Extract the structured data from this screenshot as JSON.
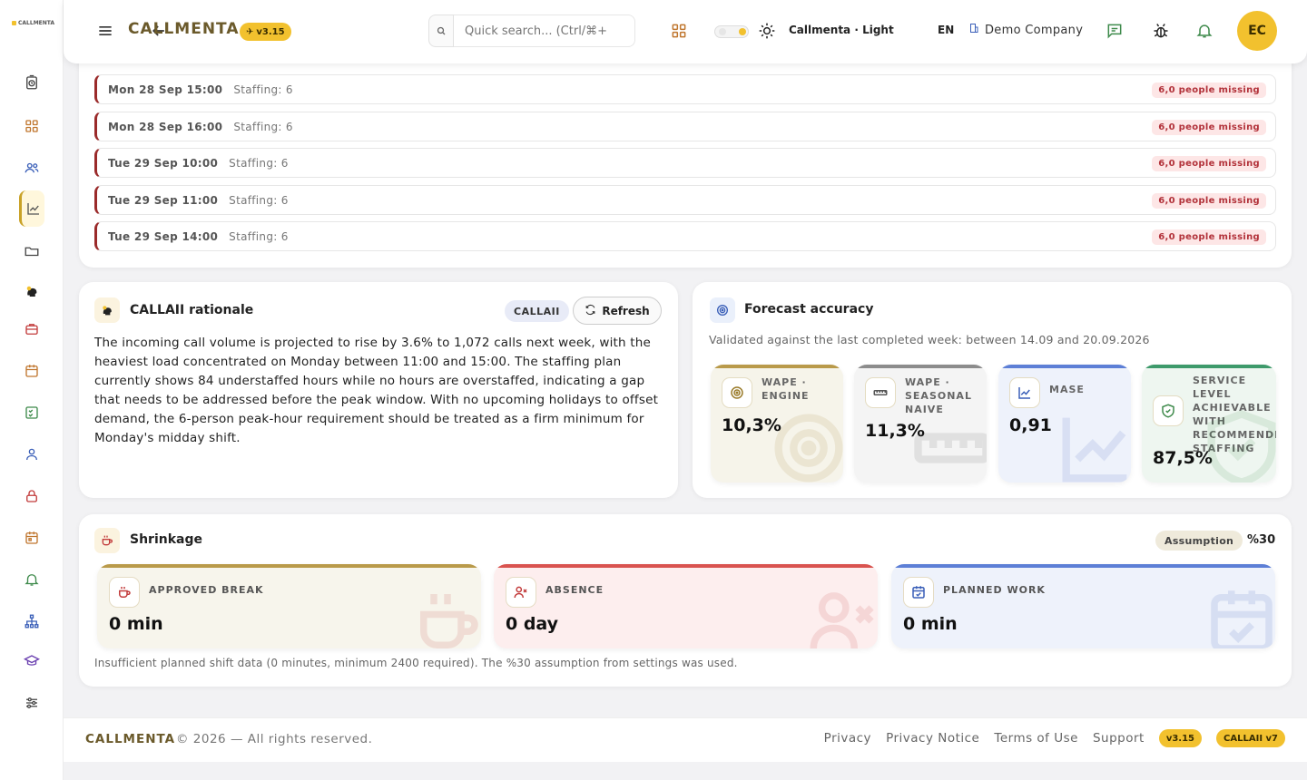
{
  "app": {
    "brand_mini": "CALLMENTA",
    "name": "CALLMENTA",
    "version": "v3.15"
  },
  "header": {
    "search_placeholder": "Quick search... (Ctrl/⌘+",
    "theme_label": "Callmenta · Light",
    "language": "EN",
    "company": "Demo Company",
    "avatar_initials": "EC"
  },
  "alerts": [
    {
      "time": "Mon 28 Sep 15:00",
      "staffing": "Staffing: 6",
      "badge": "6,0 people missing"
    },
    {
      "time": "Mon 28 Sep 16:00",
      "staffing": "Staffing: 6",
      "badge": "6,0 people missing"
    },
    {
      "time": "Tue 29 Sep 10:00",
      "staffing": "Staffing: 6",
      "badge": "6,0 people missing"
    },
    {
      "time": "Tue 29 Sep 11:00",
      "staffing": "Staffing: 6",
      "badge": "6,0 people missing"
    },
    {
      "time": "Tue 29 Sep 14:00",
      "staffing": "Staffing: 6",
      "badge": "6,0 people missing"
    }
  ],
  "rationale": {
    "title": "CALLAII rationale",
    "tag": "CALLAII",
    "refresh_label": "Refresh",
    "text": "The incoming call volume is projected to rise by 3.6% to 1,072 calls next week, with the heaviest load concentrated on Monday between 11:00 and 15:00. The staffing plan currently shows 84 understaffed hours while no hours are overstaffed, indicating a gap that needs to be addressed before the peak window. With no upcoming holidays to offset demand, the 6-person peak-hour requirement should be treated as a firm minimum for Monday's midday shift."
  },
  "forecast": {
    "title": "Forecast accuracy",
    "subtitle": "Validated against the last completed week: between 14.09 and 20.09.2026",
    "metrics": [
      {
        "label": "WAPE · ENGINE",
        "value": "10,3%",
        "color": "#b99a4a"
      },
      {
        "label": "WAPE · SEASONAL NAIVE",
        "value": "11,3%",
        "color": "#8c8c8c"
      },
      {
        "label": "MASE",
        "value": "0,91",
        "color": "#5d7fd6"
      },
      {
        "label": "SERVICE LEVEL ACHIEVABLE WITH RECOMMENDED STAFFING",
        "value": "87,5%",
        "color": "#3e9a6b"
      }
    ]
  },
  "shrinkage": {
    "title": "Shrinkage",
    "assumption_label": "Assumption",
    "assumption_value": "%30",
    "note": "Insufficient planned shift data (0 minutes, minimum 2400 required). The %30 assumption from settings was used.",
    "items": [
      {
        "label": "APPROVED BREAK",
        "value": "0 min",
        "color": "#b99a4a"
      },
      {
        "label": "ABSENCE",
        "value": "0 day",
        "color": "#d9534f"
      },
      {
        "label": "PLANNED WORK",
        "value": "0 min",
        "color": "#5d7fd6"
      }
    ]
  },
  "footer": {
    "brand": "CALLMENTA",
    "copyright": "© 2026 — All rights reserved.",
    "links": [
      "Privacy",
      "Privacy Notice",
      "Terms of Use",
      "Support"
    ],
    "version_pill": "v3.15",
    "ai_pill": "CALLAII v7"
  },
  "colors": {
    "accent": "#f2c12e",
    "brand": "#6b5a2b",
    "danger": "#b2323a"
  },
  "icons": {
    "sidebar": [
      "timer-icon",
      "dashboard-icon",
      "users-icon",
      "chart-line-icon",
      "folder-icon",
      "ai-head-icon",
      "briefcase-icon",
      "calendar-icon",
      "checklist-icon",
      "user-icon",
      "lock-icon",
      "calendar-event-icon",
      "bell-icon",
      "org-chart-icon",
      "graduation-cap-icon",
      "sliders-icon"
    ]
  }
}
